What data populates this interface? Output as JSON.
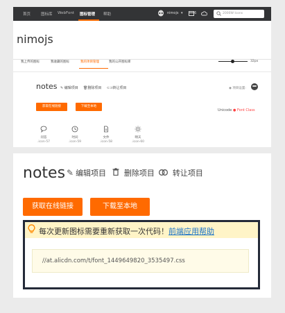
{
  "top_nav": {
    "items": [
      "首页",
      "图标库",
      "WebFont",
      "图标管理",
      "帮助"
    ],
    "active": "图标管理",
    "user": "nimojs",
    "user_caret": "▾",
    "badge_count": "6",
    "search_placeholder": "2000W Icons"
  },
  "page": {
    "title": "nimojs",
    "subtabs": [
      "我上传的图标",
      "我收藏的图标",
      "我的项目管理",
      "我的公开图标库"
    ],
    "active_subtab": "我的项目管理",
    "icon_size": "32px"
  },
  "project": {
    "name": "notes",
    "actions": [
      "编辑项目",
      "删除项目",
      "转让项目"
    ],
    "settings_label": "项目设置:",
    "buttons": [
      "获取在线链接",
      "下载至本地"
    ],
    "code_tabs": [
      "Unicode",
      "Font Class"
    ],
    "active_code_tab": "Font Class",
    "icons": [
      {
        "name": "问答",
        "code": ".icon-57"
      },
      {
        "name": "时间",
        "code": ".icon-59"
      },
      {
        "name": "文件",
        "code": ".icon-58"
      },
      {
        "name": "晴天",
        "code": ".icon-60"
      }
    ]
  },
  "zoom": {
    "notice_text": "每次更新图标需要重新获取一次代码！",
    "notice_link": "前端应用帮助",
    "code_url": "//at.alicdn.com/t/font_1449649820_3535497.css"
  },
  "icons": {
    "logo": "alien-logo-icon",
    "project": "box-icon",
    "cloud": "cloud-icon",
    "search": "search-icon",
    "edit": "pencil-icon",
    "delete": "trash-icon",
    "transfer": "link-icon",
    "settings": "eye-icon",
    "notice": "lightbulb-icon"
  },
  "colors": {
    "accent": "#ff6a00",
    "nav_bg": "#333436",
    "notice_bg": "#fff4c7",
    "link": "#1a73c8",
    "font_class_tab": "#ff4040"
  }
}
